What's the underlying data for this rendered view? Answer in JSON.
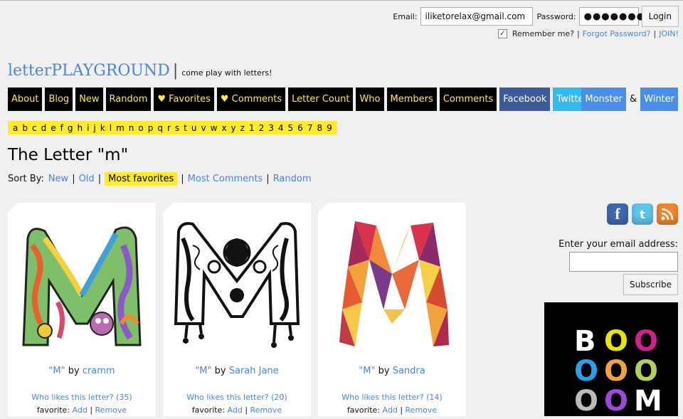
{
  "login": {
    "email_label": "Email:",
    "email_value": "iliketorelax@gmail.com",
    "password_label": "Password:",
    "password_value": "●●●●●●●●",
    "login_button": "Login",
    "remember_label": "Remember me?",
    "remember_checked": "✓",
    "forgot_link": "Forgot Password?",
    "join_link": "JOIN!"
  },
  "header": {
    "logo": "letterPLAYGROUND",
    "separator": "|",
    "tagline": "come play with letters!"
  },
  "nav": {
    "items": [
      "About",
      "Blog",
      "New",
      "Random",
      "♥ Favorites",
      "♥ Comments",
      "Letter Count",
      "Who",
      "Members",
      "Comments",
      "Facebook",
      "Twitter"
    ],
    "right": {
      "monster": "Monster",
      "amp": "&",
      "winter": "Winter"
    }
  },
  "alphabet": [
    "a",
    "b",
    "c",
    "d",
    "e",
    "f",
    "g",
    "h",
    "i",
    "j",
    "k",
    "l",
    "m",
    "n",
    "o",
    "p",
    "q",
    "r",
    "s",
    "t",
    "u",
    "v",
    "w",
    "x",
    "y",
    "z",
    "1",
    "2",
    "3",
    "4",
    "5",
    "6",
    "7",
    "8",
    "9"
  ],
  "page": {
    "title": "The Letter \"m\""
  },
  "sort": {
    "label": "Sort By:",
    "options": [
      "New",
      "Old",
      "Most favorites",
      "Most Comments",
      "Random"
    ],
    "active": "Most favorites"
  },
  "cards": [
    {
      "letter": "\"M\"",
      "by": "by",
      "author": "cramm",
      "who_likes": "Who likes this letter? (35)",
      "favorite_label": "favorite:",
      "add": "Add",
      "remove": "Remove"
    },
    {
      "letter": "\"M\"",
      "by": "by",
      "author": "Sarah Jane",
      "who_likes": "Who likes this letter? (20)",
      "favorite_label": "favorite:",
      "add": "Add",
      "remove": "Remove"
    },
    {
      "letter": "\"M\"",
      "by": "by",
      "author": "Sandra",
      "who_likes": "Who likes this letter? (14)",
      "favorite_label": "favorite:",
      "add": "Add",
      "remove": "Remove"
    }
  ],
  "sidebar": {
    "social_icons": [
      "facebook-icon",
      "twitter-icon",
      "rss-icon"
    ],
    "subscribe_label": "Enter your email address:",
    "subscribe_input": "",
    "subscribe_button": "Subscribe",
    "ad_rows": [
      [
        "B",
        "O",
        "O"
      ],
      [
        "O",
        "O",
        "O"
      ],
      [
        "O",
        "O",
        "M"
      ]
    ]
  },
  "colors": {
    "accent_link": "#4a84d8",
    "nav_bg": "#000000",
    "nav_text": "#ffe94a",
    "highlight": "#ffea2c",
    "facebook": "#3c5a99",
    "twitter": "#33bbee",
    "blue_button": "#4a8ee8"
  }
}
